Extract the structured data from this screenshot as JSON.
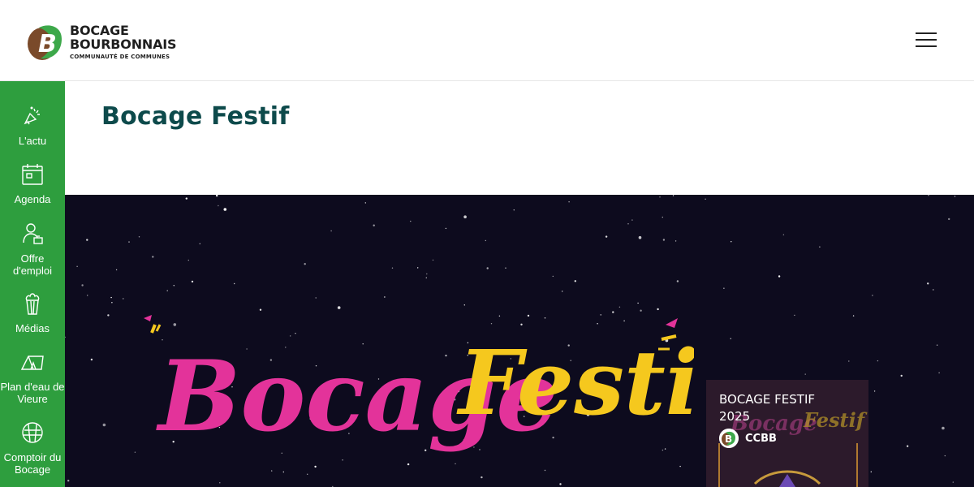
{
  "header": {
    "logo": {
      "line1": "BOCAGE",
      "line2": "BOURBONNAIS",
      "line3": "COMMUNAUTÉ DE COMMUNES"
    },
    "menu_icon": "hamburger-icon"
  },
  "sidebar": {
    "items": [
      {
        "label": "L'actu",
        "icon": "megaphone-icon"
      },
      {
        "label": "Agenda",
        "icon": "calendar-icon"
      },
      {
        "label": "Offre d'emploi",
        "icon": "job-offer-icon"
      },
      {
        "label": "Médias",
        "icon": "popcorn-icon"
      },
      {
        "label": "Plan d'eau de Vieure",
        "icon": "tent-icon"
      },
      {
        "label": "Comptoir du Bocage",
        "icon": "basket-icon"
      }
    ]
  },
  "main": {
    "title": "Bocage Festif"
  },
  "hero": {
    "logo_text_1": "Bocage",
    "logo_text_2": "Festif",
    "video": {
      "title": "BOCAGE FESTIF 2025",
      "channel": "CCBB"
    }
  },
  "colors": {
    "sidebar_green": "#2e9e3e",
    "title_teal": "#0d4a4b",
    "hero_bg": "#0d0b1e",
    "festif_pink": "#e3339a",
    "festif_yellow": "#f5c81e"
  }
}
